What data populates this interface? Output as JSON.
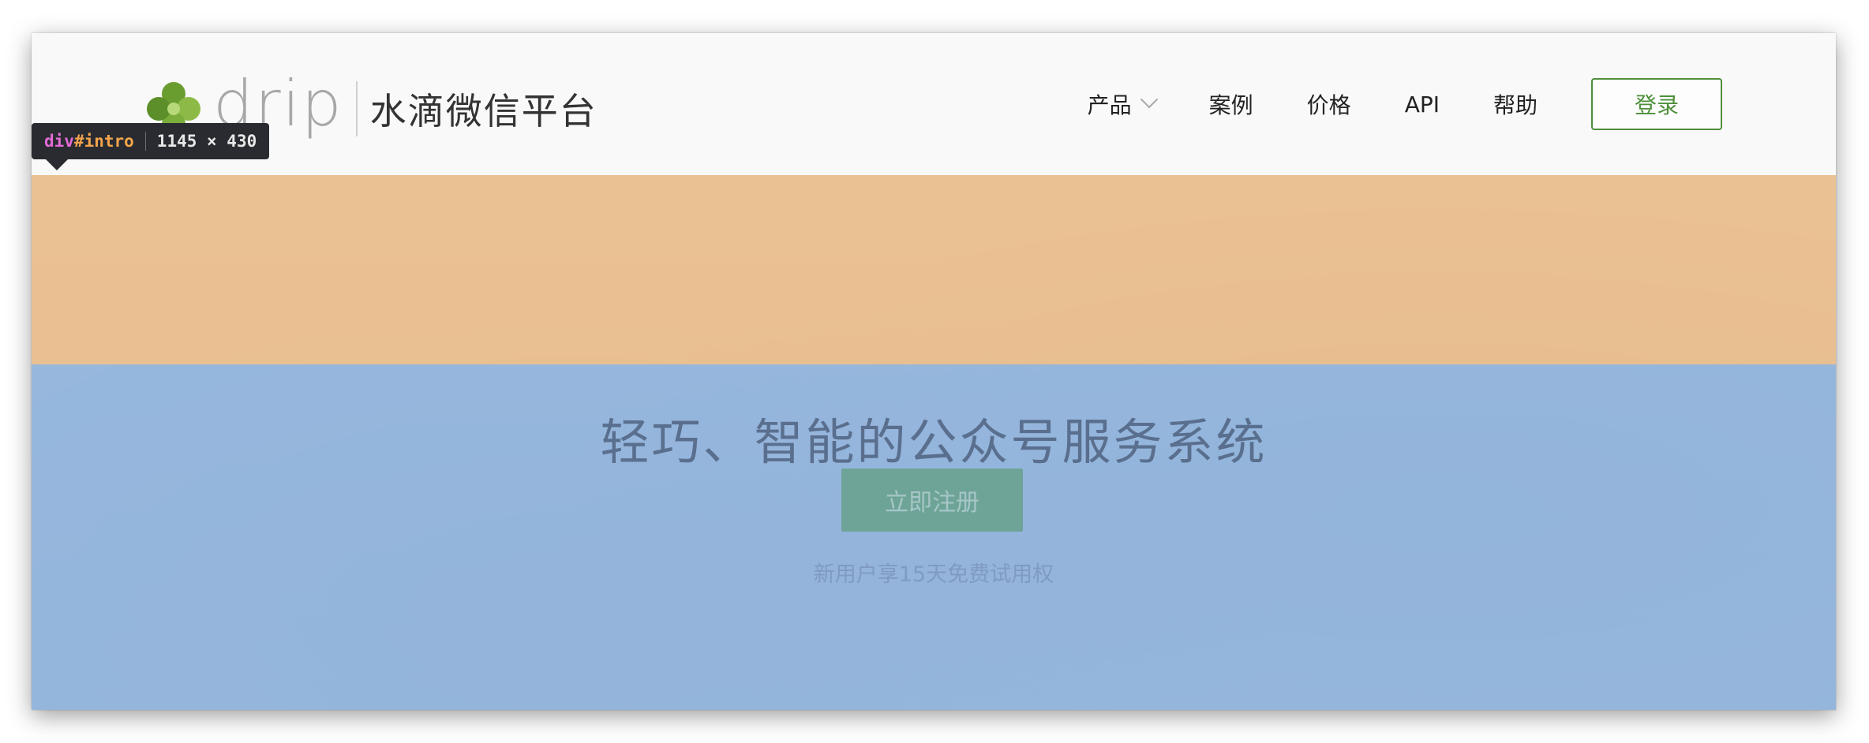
{
  "header": {
    "logo_word": "drip",
    "logo_text": "水滴微信平台"
  },
  "nav": {
    "items": [
      {
        "label": "产品",
        "has_dropdown": true
      },
      {
        "label": "案例"
      },
      {
        "label": "价格"
      },
      {
        "label": "API"
      },
      {
        "label": "帮助"
      }
    ],
    "login_label": "登录"
  },
  "inspector": {
    "tag": "div",
    "id": "#intro",
    "size": "1145 × 430"
  },
  "hero": {
    "title": "轻巧、智能的公众号服务系统",
    "cta_label": "立即注册",
    "trial_text": "新用户享15天免费试用权"
  },
  "colors": {
    "brand_green": "#4d8f3a",
    "margin_overlay": "#ebba82",
    "content_overlay": "#8cb0dc",
    "cta_bg": "#6ea497"
  }
}
